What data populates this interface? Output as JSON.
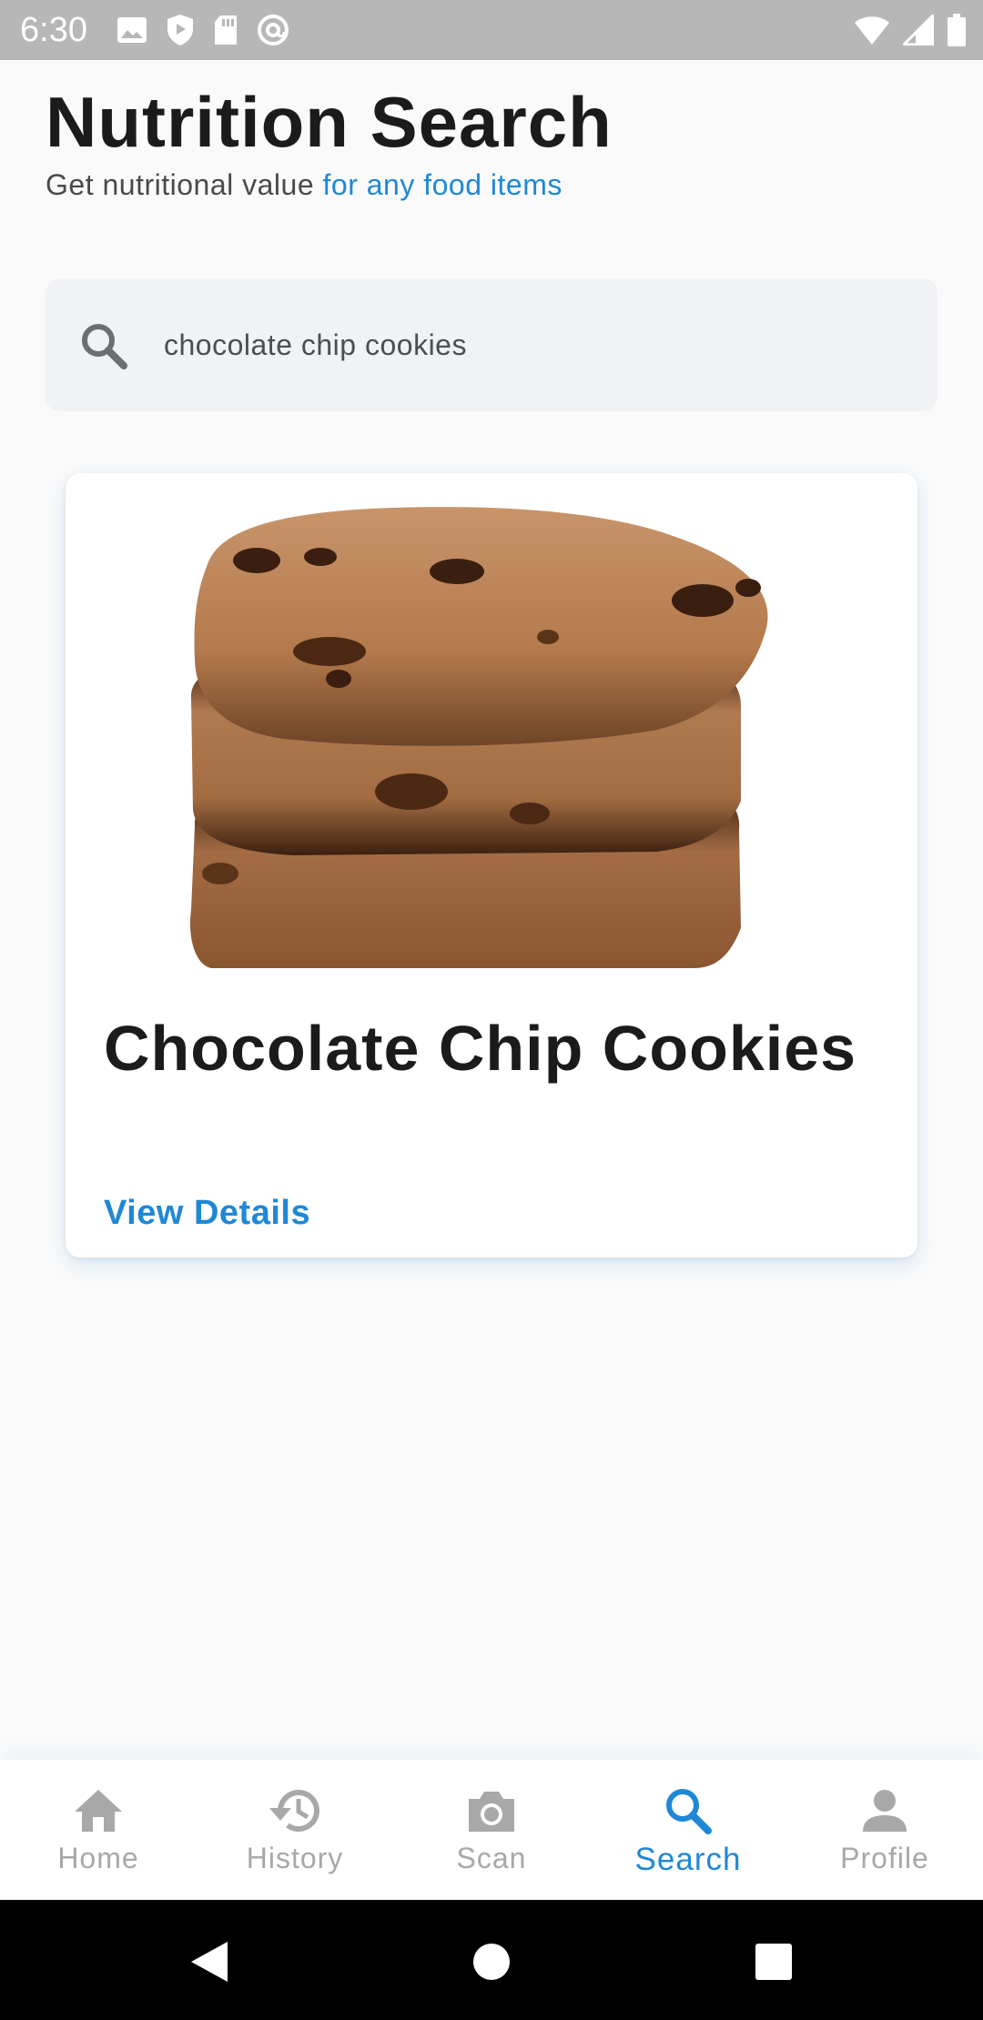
{
  "status_bar": {
    "time": "6:30",
    "left_icons": [
      "image-icon",
      "shield-icon",
      "sd-card-icon",
      "at-sign-icon"
    ],
    "right_icons": [
      "wifi-icon",
      "cell-signal-icon",
      "battery-icon"
    ]
  },
  "header": {
    "title": "Nutrition Search",
    "subtitle_plain": "Get nutritional value ",
    "subtitle_accent": "for any food items"
  },
  "search": {
    "value": "chocolate chip cookies",
    "icon": "search-icon"
  },
  "result": {
    "name": "Chocolate Chip Cookies",
    "link_label": "View Details",
    "image": "chocolate-chip-cookies-stack"
  },
  "bottom_nav": {
    "items": [
      {
        "label": "Home",
        "icon": "home-icon",
        "active": false
      },
      {
        "label": "History",
        "icon": "history-icon",
        "active": false
      },
      {
        "label": "Scan",
        "icon": "camera-icon",
        "active": false
      },
      {
        "label": "Search",
        "icon": "search-icon",
        "active": true
      },
      {
        "label": "Profile",
        "icon": "person-icon",
        "active": false
      }
    ]
  },
  "system_nav": {
    "buttons": [
      "back-icon",
      "home-circle-icon",
      "recents-icon"
    ]
  },
  "colors": {
    "accent": "#1f88d6",
    "inactive": "#a8a8a8",
    "title": "#1b1b1b",
    "status_bar": "#b7b7b7"
  }
}
